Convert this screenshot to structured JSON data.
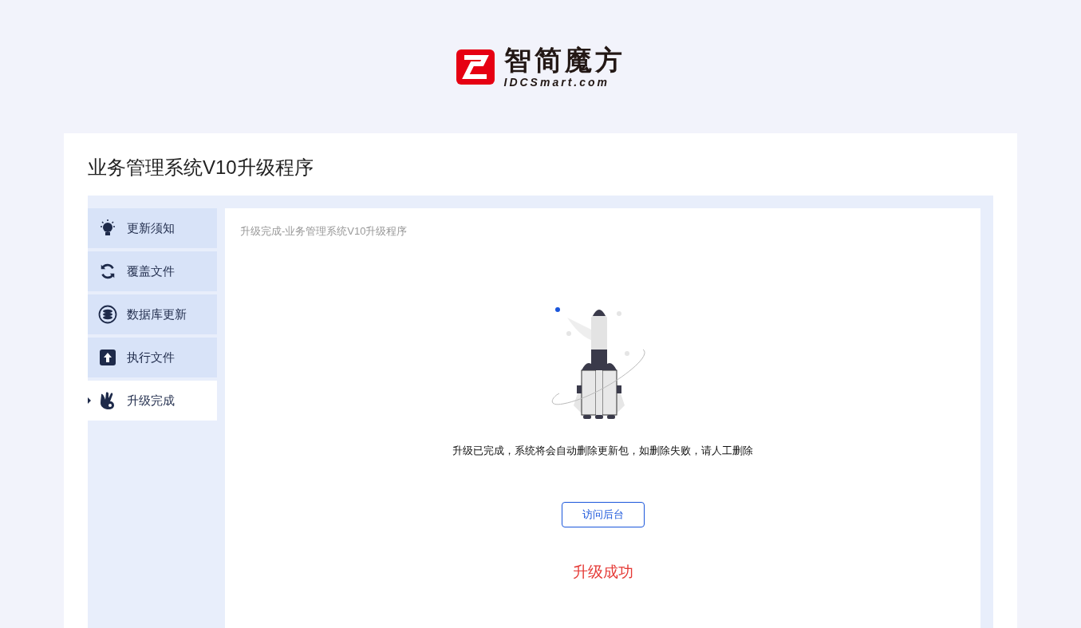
{
  "logo": {
    "name": "智简魔方",
    "domain": "IDCSmart.com"
  },
  "title": "业务管理系统V10升级程序",
  "sidebar": {
    "items": [
      {
        "label": "更新须知",
        "selected": false
      },
      {
        "label": "覆盖文件",
        "selected": false
      },
      {
        "label": "数据库更新",
        "selected": false
      },
      {
        "label": "执行文件",
        "selected": false
      },
      {
        "label": "升级完成",
        "selected": true
      }
    ]
  },
  "content": {
    "breadcrumb": "升级完成-业务管理系统V10升级程序",
    "message": "升级已完成，系统将会自动删除更新包，如删除失败，请人工删除",
    "button": "访问后台",
    "result": "升级成功"
  }
}
